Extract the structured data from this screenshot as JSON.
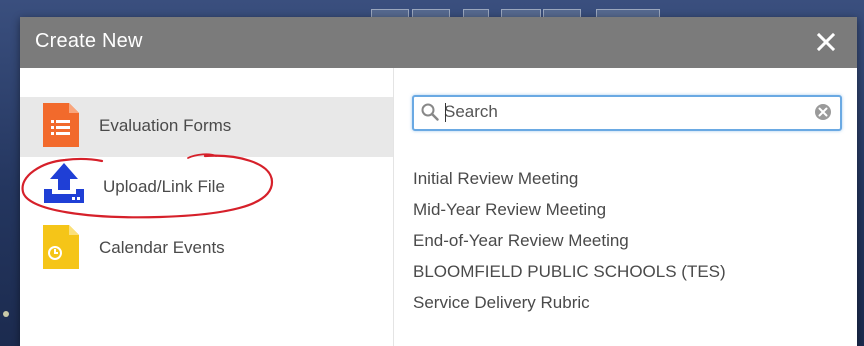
{
  "dialog": {
    "title": "Create New",
    "close_label": "×"
  },
  "categories": [
    {
      "label": "Evaluation Forms",
      "icon": "evaluation-form-icon",
      "color": "#f26a2c",
      "selected": true
    },
    {
      "label": "Upload/Link File",
      "icon": "upload-icon",
      "color": "#1f3fd6",
      "selected": false
    },
    {
      "label": "Calendar Events",
      "icon": "calendar-event-icon",
      "color": "#f5c518",
      "selected": false
    }
  ],
  "search": {
    "placeholder": "Search",
    "value": ""
  },
  "results": [
    "Initial Review Meeting",
    "Mid-Year Review Meeting",
    "End-of-Year Review Meeting",
    "BLOOMFIELD PUBLIC SCHOOLS (TES)",
    "Service Delivery Rubric"
  ],
  "colors": {
    "header_bg": "#7b7b7b",
    "focus_border": "#6aa9e3",
    "annotation": "#d6202a"
  }
}
